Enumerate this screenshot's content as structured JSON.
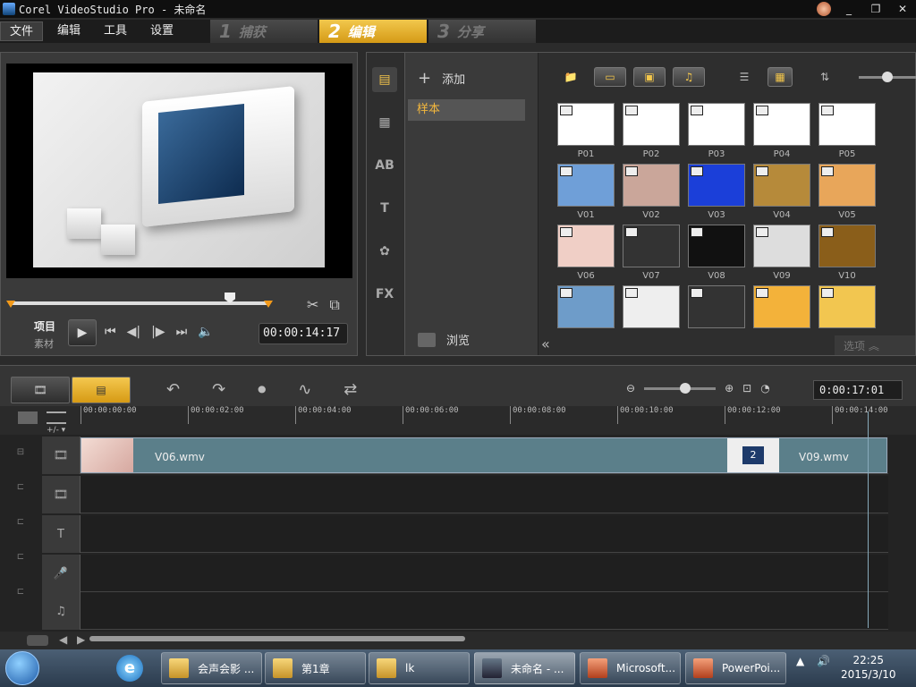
{
  "window": {
    "title": "Corel VideoStudio Pro - 未命名"
  },
  "menu": [
    {
      "label": "文件"
    },
    {
      "label": "编辑"
    },
    {
      "label": "工具"
    },
    {
      "label": "设置"
    }
  ],
  "steps": [
    {
      "num": "1",
      "label": "捕获"
    },
    {
      "num": "2",
      "label": "编辑"
    },
    {
      "num": "3",
      "label": "分享"
    }
  ],
  "preview": {
    "project_label": "项目",
    "clip_label": "素材",
    "timecode": "00:00:14:17"
  },
  "library": {
    "add_label": "添加",
    "folder": "样本",
    "browse_label": "浏览",
    "options_label": "选项",
    "thumbnails": [
      {
        "name": "P01"
      },
      {
        "name": "P02"
      },
      {
        "name": "P03"
      },
      {
        "name": "P04"
      },
      {
        "name": "P05"
      },
      {
        "name": "V01"
      },
      {
        "name": "V02"
      },
      {
        "name": "V03"
      },
      {
        "name": "V04"
      },
      {
        "name": "V05"
      },
      {
        "name": "V06"
      },
      {
        "name": "V07"
      },
      {
        "name": "V08"
      },
      {
        "name": "V09"
      },
      {
        "name": "V10"
      },
      {
        "name": ""
      },
      {
        "name": ""
      },
      {
        "name": ""
      },
      {
        "name": ""
      },
      {
        "name": ""
      }
    ]
  },
  "timeline": {
    "time": "0:00:17:01",
    "ruler": [
      "00:00:00:00",
      "00:00:02:00",
      "00:00:04:00",
      "00:00:06:00",
      "00:00:08:00",
      "00:00:10:00",
      "00:00:12:00",
      "00:00:14:00"
    ],
    "clip1": "V06.wmv",
    "clip2": "V09.wmv",
    "marker_label": "+/- ▾"
  },
  "taskbar": {
    "tasks": [
      {
        "label": "会声会影 ..."
      },
      {
        "label": "第1章"
      },
      {
        "label": "lk"
      },
      {
        "label": "未命名 - ..."
      },
      {
        "label": "Microsoft..."
      },
      {
        "label": "PowerPoi..."
      }
    ],
    "time": "22:25",
    "date": "2015/3/10"
  }
}
